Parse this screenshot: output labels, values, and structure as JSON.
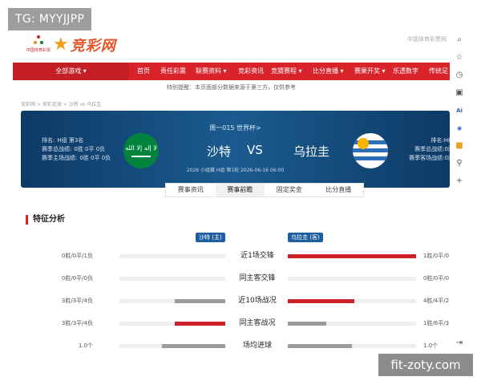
{
  "overlay": {
    "tg_label": "TG: MYYJJPP",
    "watermark": "fit-zoty.com"
  },
  "header": {
    "emblem_text": "中国体育彩票",
    "brand_name": "竞彩网",
    "right_link": "中国体育彩票网"
  },
  "nav": {
    "all_games": "全部游戏 ▾",
    "items": [
      "首页",
      "责任彩票",
      "联赛资料 ▾",
      "竞彩资讯",
      "竞猜赛程 ▾",
      "比分直播 ▾",
      "赛果开奖 ▾",
      "乐透数字",
      "传统足"
    ]
  },
  "notice": "特别提醒：本页面部分数据来源于第三方，仅供参考",
  "breadcrumb": "竞彩网 > 竞彩足球 > 沙特 vs 乌拉圭",
  "match": {
    "round": "周一015 世界杯>",
    "home_team": "沙特",
    "away_team": "乌拉圭",
    "vs": "VS",
    "meta": "2026 小组赛 H组 第1轮 2026-06-16 06:00",
    "home_flag_script": "لا إله إلا الله",
    "home_info": [
      {
        "k": "排名:",
        "v": "H组 第3名"
      },
      {
        "k": "赛季总战绩:",
        "v": "0胜 0平 0负"
      },
      {
        "k": "赛季主场战绩:",
        "v": "0胜 0平 0负"
      }
    ],
    "away_info": [
      {
        "k": "排名:",
        "v": "H组"
      },
      {
        "k": "赛季总战绩:",
        "v": "0胜"
      },
      {
        "k": "赛季客场战绩:",
        "v": "0胜"
      }
    ]
  },
  "tabs": [
    "赛事资讯",
    "赛事前瞻",
    "固定奖金",
    "比分直播"
  ],
  "active_tab": 1,
  "analysis": {
    "title": "特征分析",
    "home_tag": "沙特 (主)",
    "away_tag": "乌拉圭 (客)",
    "rows": [
      {
        "label": "近1场交锋",
        "left": "0胜/0平/1负",
        "right": "1胜/0平/0",
        "left_frac": 0.0,
        "right_frac": 1.0,
        "left_color": "#9b9b9b",
        "right_color": "#cc2128"
      },
      {
        "label": "同主客交锋",
        "left": "0胜/0平/0负",
        "right": "0胜/0平/0",
        "left_frac": 0.0,
        "right_frac": 0.0,
        "left_color": "#9b9b9b",
        "right_color": "#cc2128"
      },
      {
        "label": "近10场战况",
        "left": "3胜/3平/4负",
        "right": "4胜/4平/2",
        "left_frac": 0.48,
        "right_frac": 0.52,
        "left_color": "#9b9b9b",
        "right_color": "#cc2128"
      },
      {
        "label": "同主客战况",
        "left": "3胜/3平/4负",
        "right": "1胜/6平/3",
        "left_frac": 0.48,
        "right_frac": 0.3,
        "left_color": "#cc2128",
        "right_color": "#9b9b9b"
      },
      {
        "label": "场均进球",
        "left": "1.0个",
        "right": "1.0个",
        "left_frac": 0.6,
        "right_frac": 0.5,
        "left_color": "#9b9b9b",
        "right_color": "#9b9b9b"
      }
    ]
  },
  "sidebar": {
    "icons": [
      {
        "name": "search-icon",
        "glyph": "⌕",
        "style": ""
      },
      {
        "name": "star-icon",
        "glyph": "☆",
        "style": ""
      },
      {
        "name": "history-icon",
        "glyph": "◷",
        "style": ""
      },
      {
        "name": "briefcase-icon",
        "glyph": "▣",
        "style": ""
      },
      {
        "name": "ai-icon",
        "glyph": "Ai",
        "style": "blue"
      },
      {
        "name": "gamepad-icon",
        "glyph": "◉",
        "style": "blue"
      },
      {
        "name": "gift-icon",
        "glyph": "■",
        "style": "orange"
      },
      {
        "name": "pin-icon",
        "glyph": "⚲",
        "style": ""
      },
      {
        "name": "add-icon",
        "glyph": "+",
        "style": ""
      },
      {
        "name": "collapse-icon",
        "glyph": "⇥",
        "style": ""
      }
    ]
  }
}
